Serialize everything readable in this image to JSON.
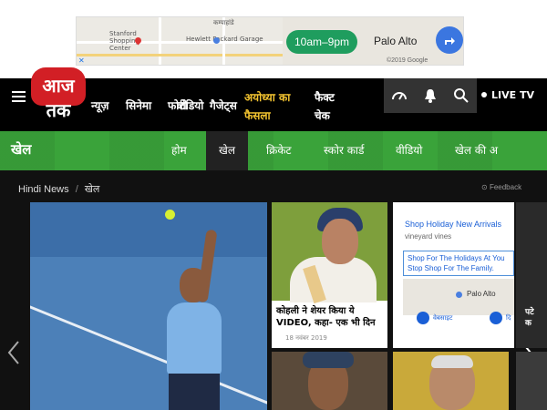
{
  "ad_top": {
    "map_labels": [
      "कम्पाहांडे",
      "Stanford Shopping Center",
      "Hewlett Packard Garage"
    ],
    "hours": "10am–9pm",
    "place": "Palo Alto",
    "google": "©2019 Google"
  },
  "header": {
    "logo": "आज तक",
    "nav": [
      "न्यूज़",
      "सिनेमा",
      "फोटो",
      "वीडियो",
      "गैजेट्स",
      "अयोध्या का फैसला",
      "फैक्ट चेक"
    ],
    "live": "LIVE TV"
  },
  "section": {
    "title": "खेल",
    "tabs": [
      "होम",
      "खेल",
      "क्रिकेट",
      "स्कोर कार्ड",
      "वीडियो",
      "खेल की अ"
    ]
  },
  "breadcrumb": {
    "home": "Hindi News",
    "sep": "/",
    "current": "खेल"
  },
  "feedback": "Feedback",
  "cards": {
    "kohli": {
      "headline": "कोहली ने शेयर किया ये VIDEO, कहा- एक भी दिन",
      "date": "18 नवंबर 2019"
    }
  },
  "ad_card": {
    "headline": "Shop Holiday New Arrivals",
    "brand": "vineyard vines",
    "body_line1": "Shop For The Holidays At You",
    "body_line2": "Stop Shop For The Family.",
    "map_label": "Palo Alto",
    "btn1": "वेबसाइट",
    "btn2": "दि"
  },
  "edge_card_text": "पटे\nक"
}
